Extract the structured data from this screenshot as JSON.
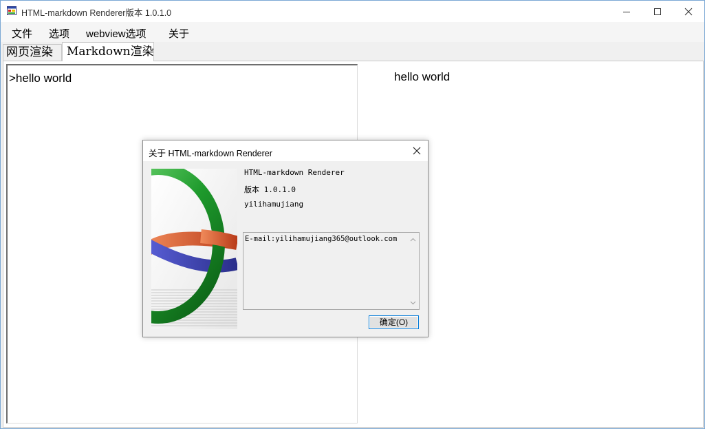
{
  "window": {
    "title": "HTML-markdown Renderer版本 1.0.1.0",
    "icon": "app-window-icon",
    "controls": [
      "minimize-icon",
      "maximize-icon",
      "close-icon"
    ]
  },
  "menu": {
    "items": [
      "文件",
      "选项",
      "webview选项",
      "关于"
    ]
  },
  "tabs": [
    {
      "label": "网页渲染",
      "active": false
    },
    {
      "label": "Markdown渲染",
      "active": true
    }
  ],
  "editor": {
    "content": ">hello world"
  },
  "preview": {
    "content": "hello world"
  },
  "about_dialog": {
    "title": "关于 HTML-markdown Renderer",
    "product_name": "HTML-markdown Renderer",
    "version": "版本 1.0.1.0",
    "author": "yilihamujiang",
    "description": "E-mail:yilihamujiang365@outlook.com",
    "ok_label": "确定(O)",
    "logo": "interlocking-rings-logo"
  },
  "colors": {
    "accent": "#0078d7",
    "ring_green": "#1e9a2c",
    "ring_red": "#d9542a",
    "ring_blue": "#3a3fae"
  }
}
